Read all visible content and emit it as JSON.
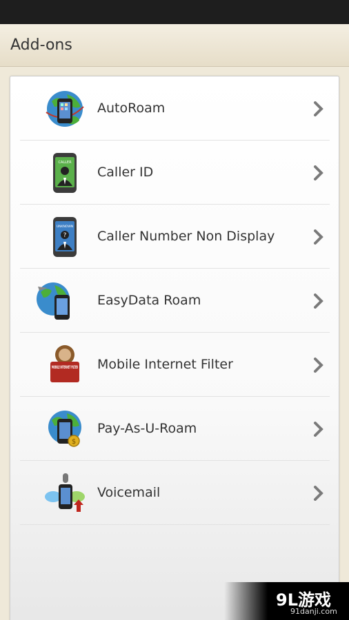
{
  "action_bar": {
    "title": "Add-ons"
  },
  "list": {
    "items": [
      {
        "label": "AutoRoam",
        "icon": "globe-phone-icon"
      },
      {
        "label": "Caller ID",
        "icon": "caller-id-phone-icon"
      },
      {
        "label": "Caller Number Non Display",
        "icon": "unknown-caller-phone-icon"
      },
      {
        "label": "EasyData Roam",
        "icon": "globe-plane-phone-icon"
      },
      {
        "label": "Mobile Internet Filter",
        "icon": "internet-filter-badge-icon"
      },
      {
        "label": "Pay-As-U-Roam",
        "icon": "globe-coin-phone-icon"
      },
      {
        "label": "Voicemail",
        "icon": "voicemail-phone-icon"
      }
    ]
  },
  "caller_id_screen_text": "CALLER",
  "unknown_screen_text": "UNKNOWN",
  "filter_badge_text": "MOBILE INTERNET FILTER",
  "watermark": {
    "brand": "9L游戏",
    "site": "91danji.com"
  },
  "colors": {
    "status_bar": "#1e1e1e",
    "action_bar": "#efe9d9",
    "chevron": "#7a7a7a"
  }
}
